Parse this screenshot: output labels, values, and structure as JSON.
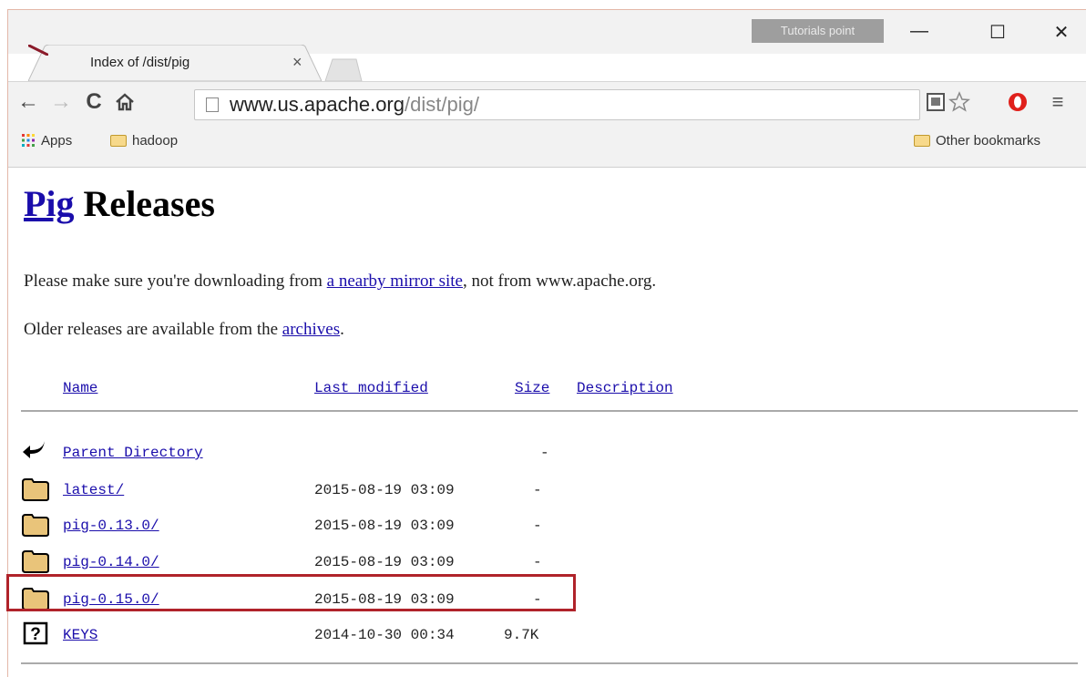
{
  "browser": {
    "tab_title": "Index of /dist/pig",
    "tab_close": "×",
    "badge": "Tutorials point",
    "url_host": "www.us.apache.org",
    "url_path": "/dist/pig/",
    "bookmarks": {
      "apps": "Apps",
      "hadoop": "hadoop",
      "other": "Other bookmarks"
    },
    "window_controls": {
      "minimize": "—",
      "maximize": "☐",
      "close": "✕"
    }
  },
  "page": {
    "heading_link": "Pig",
    "heading_rest": " Releases",
    "mirror_text_before": "Please make sure you're downloading from ",
    "mirror_link": "a nearby mirror site",
    "mirror_text_after": ", not from www.apache.org.",
    "older_text": "Older releases are available from the ",
    "archives_link": "archives",
    "older_period": "."
  },
  "listing": {
    "columns": {
      "name": "Name",
      "modified": "Last modified",
      "size": "Size",
      "description": "Description"
    },
    "rows": [
      {
        "name": "Parent Directory",
        "modified": "",
        "size": "-",
        "icon": "back-arrow-icon"
      },
      {
        "name": "latest/",
        "modified": "2015-08-19 03:09",
        "size": "-",
        "icon": "folder-icon"
      },
      {
        "name": "pig-0.13.0/",
        "modified": "2015-08-19 03:09",
        "size": "-",
        "icon": "folder-icon"
      },
      {
        "name": "pig-0.14.0/",
        "modified": "2015-08-19 03:09",
        "size": "-",
        "icon": "folder-icon"
      },
      {
        "name": "pig-0.15.0/",
        "modified": "2015-08-19 03:09",
        "size": "-",
        "icon": "folder-icon"
      },
      {
        "name": "KEYS",
        "modified": "2014-10-30 00:34",
        "size": "9.7K",
        "icon": "unknown-file-icon"
      }
    ],
    "highlight_color": "#b0232a"
  }
}
